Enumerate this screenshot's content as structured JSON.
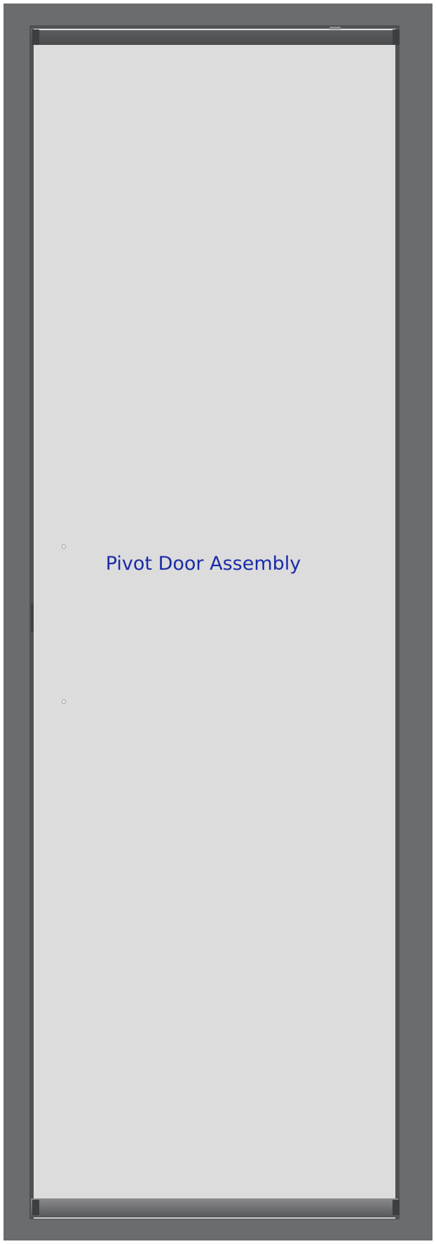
{
  "title": "Pivot Door Assembly",
  "labels": {
    "top_label": "",
    "bottom_label": ""
  },
  "colors": {
    "frame": "#6b6c6e",
    "glass": "#dcdcdc",
    "title_text": "#1a2aa8"
  },
  "icons": {
    "hinge_holes": "circle"
  }
}
